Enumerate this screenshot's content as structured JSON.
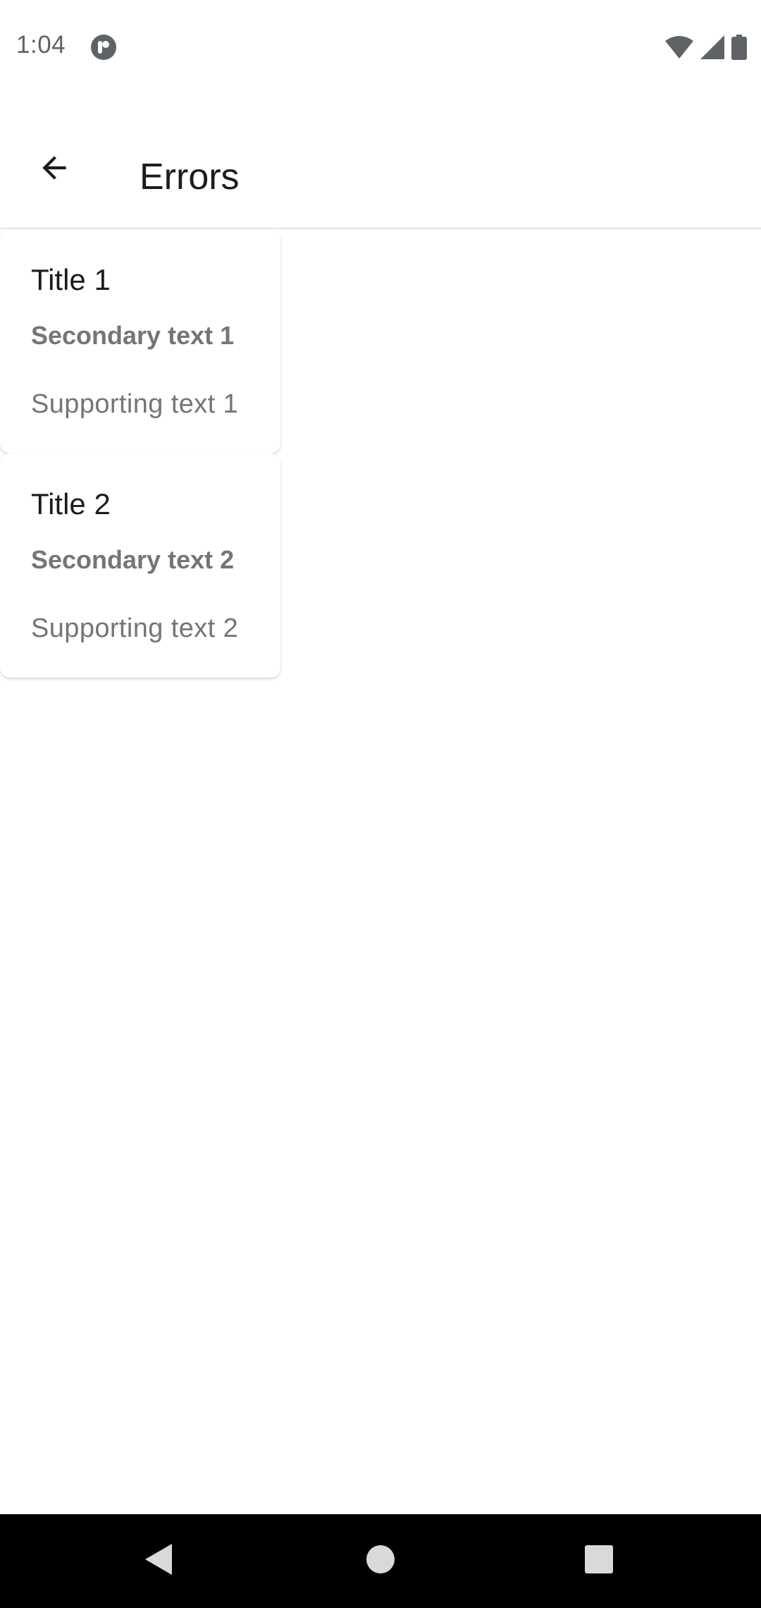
{
  "status_bar": {
    "time": "1:04",
    "icons": [
      "app-notification-icon",
      "wifi-icon",
      "cellular-signal-icon",
      "battery-icon"
    ]
  },
  "app_bar": {
    "title": "Errors",
    "back_icon": "arrow-back-icon"
  },
  "cards": [
    {
      "title": "Title 1",
      "secondary": "Secondary text 1",
      "supporting": "Supporting text 1"
    },
    {
      "title": "Title 2",
      "secondary": "Secondary text 2",
      "supporting": "Supporting text 2"
    }
  ],
  "nav_bar": {
    "buttons": [
      "back-triangle-icon",
      "home-circle-icon",
      "recents-square-icon"
    ]
  },
  "colors": {
    "background": "#ffffff",
    "text_primary": "#1c1b1f",
    "text_secondary": "#757575",
    "nav_bar": "#000000"
  }
}
